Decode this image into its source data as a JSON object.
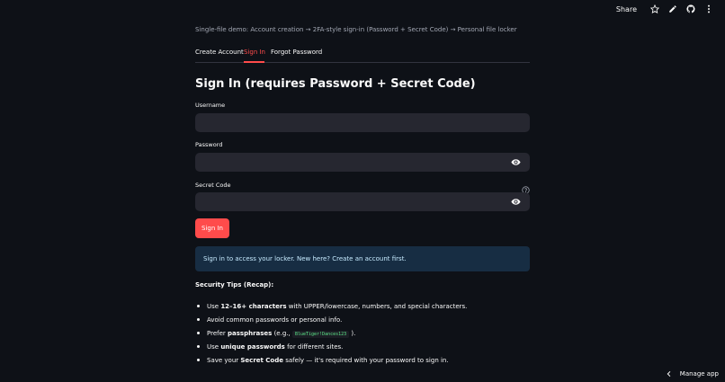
{
  "toolbar": {
    "share_label": "Share",
    "icons": [
      "star-icon",
      "edit-icon",
      "github-icon",
      "more-icon"
    ]
  },
  "caption": "Single-file demo: Account creation → 2FA-style sign-in (Password + Secret Code) → Personal file locker",
  "tabs": [
    {
      "label": "Create Account",
      "active": false
    },
    {
      "label": "Sign In",
      "active": true
    },
    {
      "label": "Forgot Password",
      "active": false
    }
  ],
  "title": "Sign In (requires Password + Secret Code)",
  "form": {
    "username_label": "Username",
    "username_value": "",
    "password_label": "Password",
    "password_value": "",
    "secret_label": "Secret Code",
    "secret_value": "",
    "submit_label": "Sign In"
  },
  "info_message": "Sign in to access your locker. New here? Create an account first.",
  "tips": {
    "title": "Security Tips (Recap):",
    "items": [
      {
        "pre": "Use ",
        "bold": "12–16+ characters",
        "post": " with UPPER/lowercase, numbers, and special characters."
      },
      {
        "pre": "Avoid common passwords or personal info.",
        "bold": "",
        "post": ""
      },
      {
        "pre": "Prefer ",
        "bold": "passphrases",
        "post": " (e.g., ",
        "code": "BlueTiger!Dances123",
        "after": " )."
      },
      {
        "pre": "Use ",
        "bold": "unique passwords",
        "post": " for different sites."
      },
      {
        "pre": "Save your ",
        "bold": "Secret Code",
        "post": " safely — it's required with your password to sign in."
      }
    ]
  },
  "manage_app_label": "Manage app",
  "colors": {
    "background": "#0e1117",
    "accent": "#ff4b4b",
    "field_bg": "#262730",
    "info_bg": "#172d43",
    "info_text": "#c7ebff"
  }
}
